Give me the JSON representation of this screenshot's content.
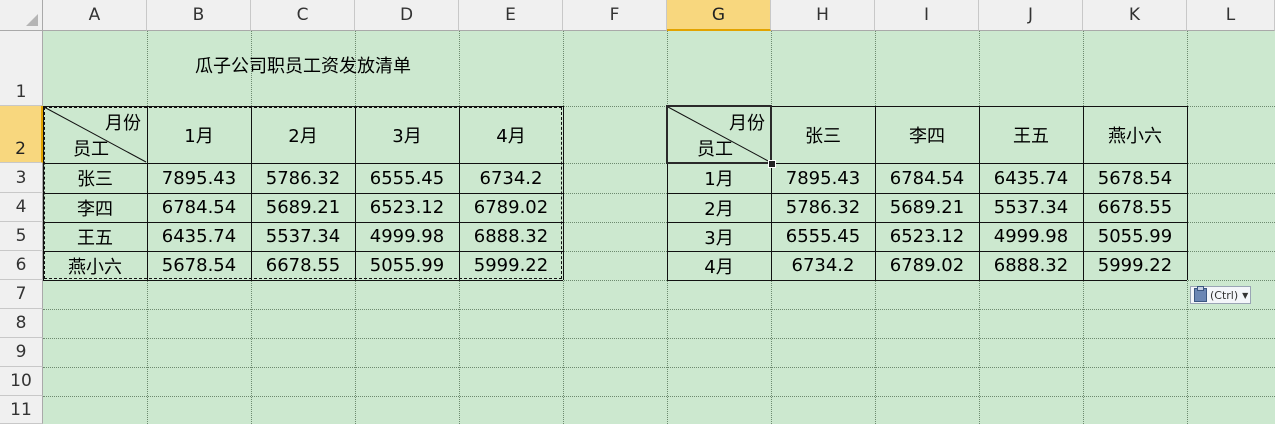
{
  "columns": [
    "A",
    "B",
    "C",
    "D",
    "E",
    "F",
    "G",
    "H",
    "I",
    "J",
    "K",
    "L"
  ],
  "rows": [
    "1",
    "2",
    "3",
    "4",
    "5",
    "6",
    "7",
    "8",
    "9",
    "10",
    "11"
  ],
  "selected_column": "G",
  "selected_row": "2",
  "title": "瓜子公司职员工资发放清单",
  "left_table": {
    "header_top": "月份",
    "header_bottom": "员工",
    "col_headers": [
      "1月",
      "2月",
      "3月",
      "4月"
    ],
    "row_headers": [
      "张三",
      "李四",
      "王五",
      "燕小六"
    ],
    "values": [
      [
        "7895.43",
        "5786.32",
        "6555.45",
        "6734.2"
      ],
      [
        "6784.54",
        "5689.21",
        "6523.12",
        "6789.02"
      ],
      [
        "6435.74",
        "5537.34",
        "4999.98",
        "6888.32"
      ],
      [
        "5678.54",
        "6678.55",
        "5055.99",
        "5999.22"
      ]
    ]
  },
  "right_table": {
    "header_top": "月份",
    "header_bottom": "员工",
    "col_headers": [
      "张三",
      "李四",
      "王五",
      "燕小六"
    ],
    "row_headers": [
      "1月",
      "2月",
      "3月",
      "4月"
    ],
    "values": [
      [
        "7895.43",
        "6784.54",
        "6435.74",
        "5678.54"
      ],
      [
        "5786.32",
        "5689.21",
        "5537.34",
        "6678.55"
      ],
      [
        "6555.45",
        "6523.12",
        "4999.98",
        "5055.99"
      ],
      [
        "6734.2",
        "6789.02",
        "6888.32",
        "5999.22"
      ]
    ]
  },
  "paste_options": {
    "label": "(Ctrl)",
    "icon": "clipboard-icon"
  }
}
